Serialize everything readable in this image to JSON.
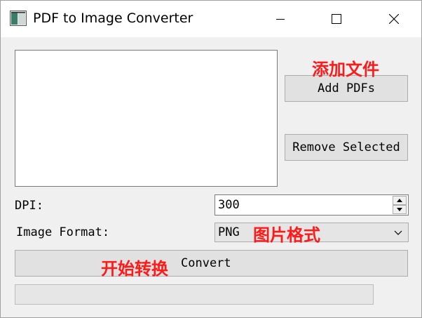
{
  "window": {
    "title": "PDF to Image Converter",
    "icon": "app-icon",
    "controls": [
      "minimize-icon",
      "maximize-icon",
      "close-icon"
    ]
  },
  "file_list": {
    "items": []
  },
  "buttons": {
    "add_label": "Add PDFs",
    "remove_label": "Remove Selected",
    "convert_label": "Convert"
  },
  "annotations": {
    "add_cn": "添加文件",
    "format_cn": "图片格式",
    "convert_cn": "开始转换",
    "color": "#ff1a1a"
  },
  "dpi": {
    "label": "DPI:",
    "value": "300"
  },
  "format": {
    "label": "Image Format:",
    "selected": "PNG"
  },
  "progress": {
    "value": 0
  },
  "colors": {
    "window_bg": "#f0f0f0",
    "button_bg": "#e1e1e1",
    "titlebar_bg": "#ffffff"
  }
}
